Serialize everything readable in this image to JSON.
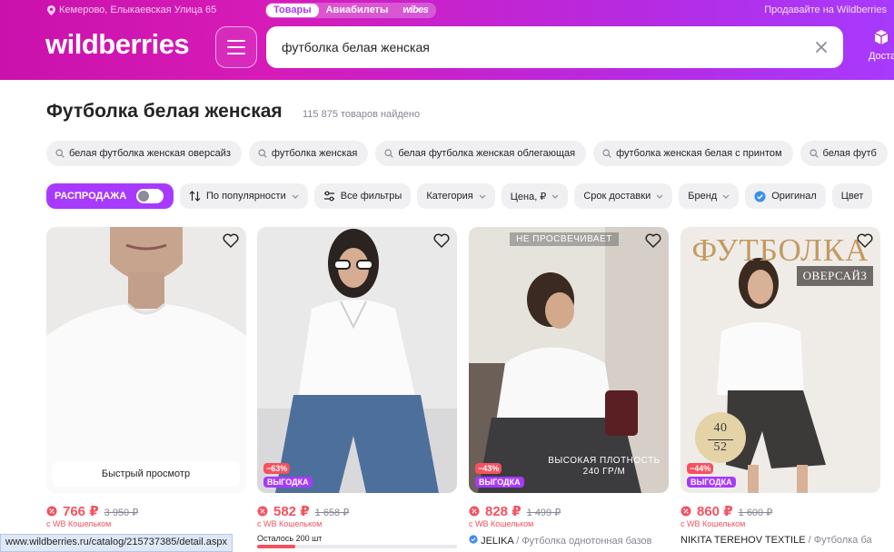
{
  "header": {
    "address": "Кемерово, Елыкаевская Улица 65",
    "tabs": [
      "Товары",
      "Авиабилеты",
      "wibes"
    ],
    "sell_link": "Продавайте на Wildberries",
    "logo": "wildberries",
    "search_value": "футболка белая женская",
    "delivery_label": "Достав"
  },
  "page": {
    "title": "Футболка белая женская",
    "found": "115 875 товаров найдено"
  },
  "suggestions": [
    "белая футболка женская оверсайз",
    "футболка женская",
    "белая футболка женская облегающая",
    "футболка женская белая с принтом",
    "белая футб"
  ],
  "filters": {
    "sale_label": "РАСПРОДАЖА",
    "sort": "По популярности",
    "all_filters": "Все фильтры",
    "category": "Категория",
    "price": "Цена, ₽",
    "delivery_time": "Срок доставки",
    "brand": "Бренд",
    "original": "Оригинал",
    "color": "Цвет"
  },
  "products": [
    {
      "price": "766 ₽",
      "old_price": "3 950 ₽",
      "wallet": "с WB Кошельком",
      "quick_view": "Быстрый просмотр"
    },
    {
      "price": "582 ₽",
      "old_price": "1 658 ₽",
      "wallet": "с WB Кошельком",
      "discount": "−63%",
      "badge": "ВЫГОДКА",
      "stock": "Осталось 200 шт"
    },
    {
      "price": "828 ₽",
      "old_price": "1 499 ₽",
      "wallet": "с WB Кошельком",
      "discount": "−43%",
      "badge": "ВЫГОДКА",
      "brand": "JELIKA",
      "name": "/ Футболка однотонная базов",
      "photo_top_text": "НЕ ПРОСВЕЧИВАЕТ",
      "photo_bottom_text": "ВЫСОКАЯ ПЛОТНОСТЬ 240 ГР/М"
    },
    {
      "price": "860 ₽",
      "old_price": "1 600 ₽",
      "wallet": "с WB Кошельком",
      "discount": "−44%",
      "badge": "ВЫГОДКА",
      "brand": "NIKITA TEREHOV TEXTILE",
      "name": "/ Футболка ба",
      "photo_title": "ФУТБОЛКА",
      "photo_subtitle": "ОВЕРСАЙЗ",
      "size_top": "40",
      "size_bottom": "52"
    }
  ],
  "status_url": "www.wildberries.ru/catalog/215737385/detail.aspx",
  "colors": {
    "accent": "#a73afd",
    "brand_pink": "#cb11ab",
    "sale_red": "#f5515f"
  }
}
